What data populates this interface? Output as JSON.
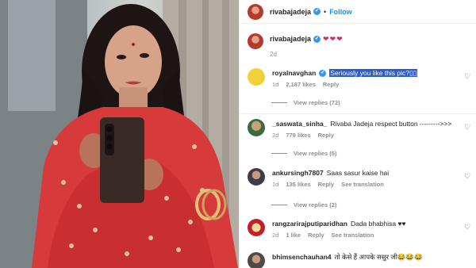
{
  "header": {
    "username": "rivabajadeja",
    "verified_mark": "✔",
    "separator": "•",
    "follow_label": "Follow"
  },
  "caption": {
    "username": "rivabajadeja",
    "verified_mark": "✔",
    "hearts": "❤❤❤",
    "age": "2d"
  },
  "comments": [
    {
      "username": "royalnavghan",
      "verified_mark": "✔",
      "text": "Seriously you like this pic?",
      "text_suffix": "▯▯",
      "age": "1d",
      "likes": "2,187 likes",
      "reply": "Reply",
      "view_replies": "View replies (72)"
    },
    {
      "username": "_saswata_sinha_",
      "text": "Rivaba Jadeja respect button --------->>>",
      "age": "2d",
      "likes": "779 likes",
      "reply": "Reply",
      "view_replies": "View replies (5)"
    },
    {
      "username": "ankursingh7807",
      "text": "Saas sasur kaise hai",
      "age": "1d",
      "likes": "135 likes",
      "reply": "Reply",
      "translate": "See translation",
      "view_replies": "View replies (2)"
    },
    {
      "username": "rangzarirajputiparidhan",
      "text": "Dada bhabhisa ♥♥",
      "age": "2d",
      "likes": "1 like",
      "reply": "Reply",
      "translate": "See translation"
    },
    {
      "username": "bhimsenchauhan4",
      "text": "तो केसे हैं आपके ससुर जी😂😂😂"
    }
  ],
  "colors": {
    "link_blue": "#0095f6",
    "verified_blue": "#3897f0",
    "muted_gray": "#8e8e8e",
    "selection_blue": "#2f5bd0",
    "heart_red": "#e0245e"
  },
  "icons": [
    "verified-badge-icon",
    "heart-outline-icon"
  ]
}
